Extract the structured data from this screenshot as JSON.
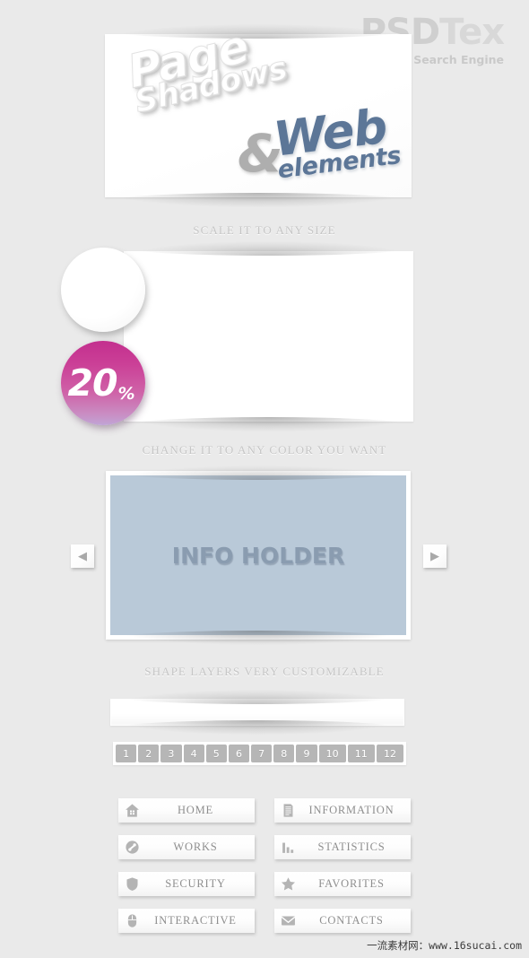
{
  "brand": {
    "name_main": "PSD",
    "name_accent": "Tex",
    "tagline": "PSD Search Engine",
    "color": "#cfcfcf"
  },
  "hero": {
    "line_page": "Page",
    "line_shadows": "Shadows",
    "ampersand": "&",
    "line_web": "Web",
    "line_elements": "elements",
    "web_color": "#5c7697",
    "amp_color": "#aeaeae"
  },
  "captions": {
    "scale": "SCALE IT TO ANY SIZE",
    "color": "CHANGE IT TO ANY COLOR YOU WANT",
    "shape": "SHAPE LAYERS VERY CUSTOMIZABLE"
  },
  "badge": {
    "value": "20",
    "unit": "%",
    "gradient_top": "#c32f8e",
    "gradient_bottom": "#c0a5d6"
  },
  "info_holder": {
    "label": "INFO HOLDER",
    "panel_color": "#b9c9d8",
    "text_color": "#8a9cb0",
    "prev_icon": "chevron-left-icon",
    "next_icon": "chevron-right-icon",
    "prev_glyph": "◀",
    "next_glyph": "▶"
  },
  "search": {
    "value": "",
    "placeholder": ""
  },
  "pagination": {
    "pages": [
      "1",
      "2",
      "3",
      "4",
      "5",
      "6",
      "7",
      "8",
      "9",
      "10",
      "11",
      "12"
    ],
    "button_color": "#b6b6b6"
  },
  "menu": {
    "items": [
      {
        "label": "HOME",
        "icon": "house-icon"
      },
      {
        "label": "INFORMATION",
        "icon": "document-icon"
      },
      {
        "label": "WORKS",
        "icon": "tools-icon"
      },
      {
        "label": "STATISTICS",
        "icon": "bar-chart-icon"
      },
      {
        "label": "SECURITY",
        "icon": "shield-icon"
      },
      {
        "label": "FAVORITES",
        "icon": "star-icon"
      },
      {
        "label": "INTERACTIVE",
        "icon": "mouse-icon"
      },
      {
        "label": "CONTACTS",
        "icon": "envelope-icon"
      }
    ]
  },
  "footer": {
    "watermark": "一流素材网：www.16sucai.com"
  }
}
